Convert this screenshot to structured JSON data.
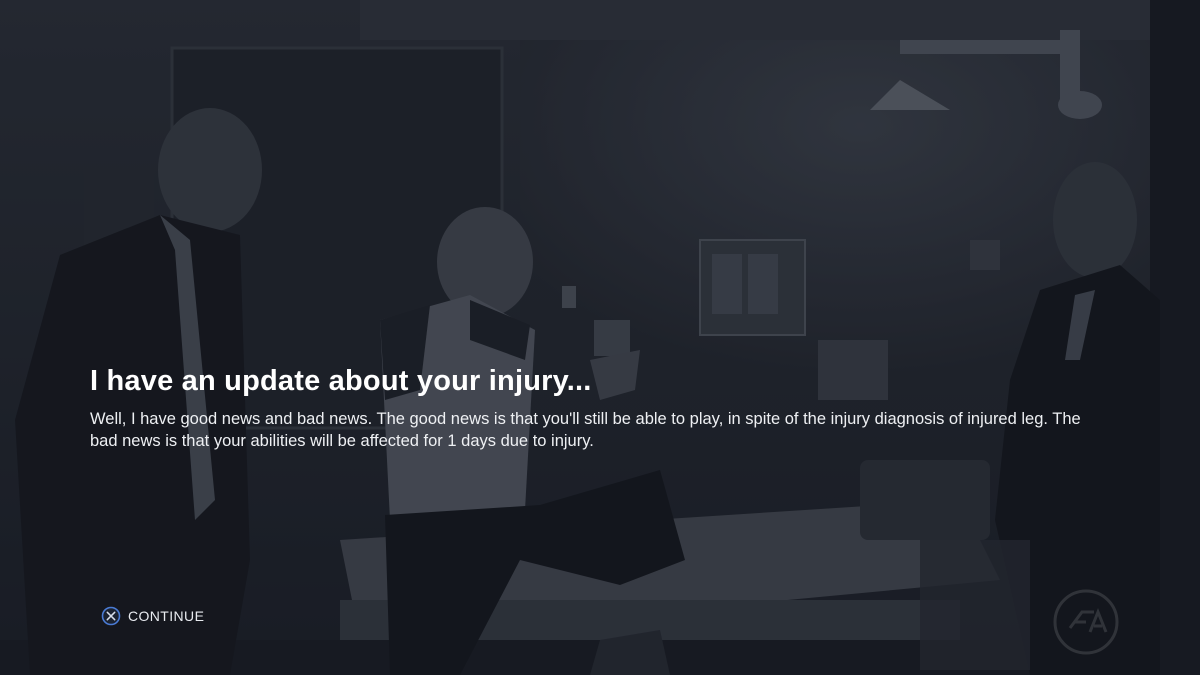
{
  "dialog": {
    "title": "I have an update about your injury...",
    "body": "Well, I have good news and bad news. The good news is that you'll still be able to play, in spite of the injury diagnosis of injured leg. The bad news is that your abilities will be affected for 1 days due to injury."
  },
  "prompt": {
    "button_icon": "cross-button-icon",
    "label": "CONTINUE"
  },
  "colors": {
    "overlay": "#10141c",
    "title_text": "#ffffff",
    "body_text": "#eef0f3",
    "prompt_ring": "#4a7bd4"
  }
}
